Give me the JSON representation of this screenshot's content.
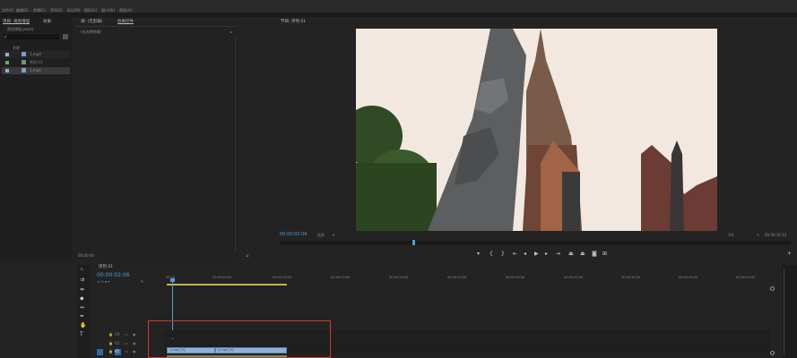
{
  "menu": [
    "文件(F)",
    "编辑(E)",
    "剪辑(C)",
    "序列(S)",
    "标记(M)",
    "图形(G)",
    "窗口(W)",
    "帮助(H)"
  ],
  "watermark": "虎课网",
  "project_panel": {
    "tab_label": "项目: 视觉增强",
    "tab2_label": "效果",
    "project_file": "视觉增强.prproj",
    "search_placeholder": "ρ",
    "column_name": "名称",
    "items": [
      "1.mp4",
      "序列 01",
      "2.mp4"
    ]
  },
  "effects_panel": {
    "tab1": "源: (无剪辑)",
    "tab2": "效果控件",
    "subtitle": "(未选择剪辑)",
    "timecode": "00:00:00"
  },
  "program_monitor": {
    "tab": "节目: 序列 01",
    "timecode": "00:00:02:06",
    "fit": "适合",
    "resolution": "1/2",
    "duration": "00:00:10:12",
    "playhead_fraction": 0.26
  },
  "timeline": {
    "tab": "序列 01",
    "timecode": "00:00:02:06",
    "ruler": [
      "00:00",
      "00:00:05:00",
      "00:00:10:00",
      "00:00:15:00",
      "00:00:20:00",
      "00:00:25:00",
      "00:00:30:00",
      "00:00:35:00",
      "00:00:40:00",
      "00:00:45:00",
      "00:00:50:00"
    ],
    "tracks": [
      "V3",
      "V2",
      "V1",
      "A1"
    ],
    "clips": [
      {
        "label": "1.mp4 [V]",
        "track": "V1"
      },
      {
        "label": "2.mp4 [V]",
        "track": "V1"
      }
    ]
  }
}
